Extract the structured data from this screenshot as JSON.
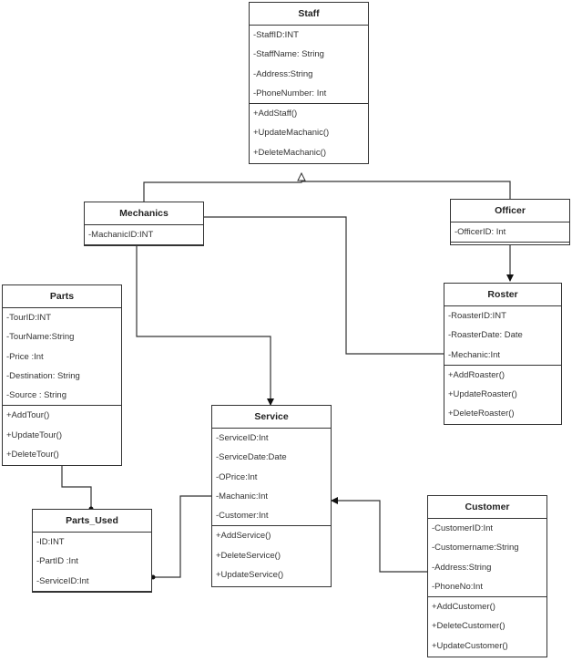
{
  "diagram": {
    "type": "UML class diagram",
    "classes": {
      "staff": {
        "name": "Staff",
        "attributes": [
          "-StaffID:INT",
          "-StaffName: String",
          "-Address:String",
          "-PhoneNumber: Int"
        ],
        "methods": [
          "+AddStaff()",
          "+UpdateMachanic()",
          "+DeleteMachanic()"
        ]
      },
      "mechanics": {
        "name": "Mechanics",
        "attributes": [
          "-MachanicID:INT"
        ],
        "methods": []
      },
      "officer": {
        "name": "Officer",
        "attributes": [
          "-OfficerID: Int"
        ],
        "methods": []
      },
      "roster": {
        "name": "Roster",
        "attributes": [
          "-RoasterID:INT",
          "-RoasterDate: Date",
          "-Mechanic:Int"
        ],
        "methods": [
          "+AddRoaster()",
          "+UpdateRoaster()",
          "+DeleteRoaster()"
        ]
      },
      "parts": {
        "name": "Parts",
        "attributes": [
          "-TourID:INT",
          "-TourName:String",
          "-Price :Int",
          "-Destination: String",
          "-Source : String"
        ],
        "methods": [
          "+AddTour()",
          "+UpdateTour()",
          "+DeleteTour()"
        ]
      },
      "service": {
        "name": "Service",
        "attributes": [
          "-ServiceID:Int",
          "-ServiceDate:Date",
          "-OPrice:Int",
          "-Machanic:Int",
          "-Customer:Int"
        ],
        "methods": [
          "+AddService()",
          "+DeleteService()",
          "+UpdateService()"
        ]
      },
      "parts_used": {
        "name": "Parts_Used",
        "attributes": [
          "-ID:INT",
          "-PartID :Int",
          "-ServiceID:Int"
        ],
        "methods": []
      },
      "customer": {
        "name": "Customer",
        "attributes": [
          "-CustomerID:Int",
          "-Customername:String",
          "-Address:String",
          "-PhoneNo:Int"
        ],
        "methods": [
          "+AddCustomer()",
          "+DeleteCustomer()",
          "+UpdateCustomer()"
        ]
      }
    },
    "relationships": [
      {
        "from": "Mechanics",
        "to": "Staff",
        "type": "generalization"
      },
      {
        "from": "Officer",
        "to": "Staff",
        "type": "generalization"
      },
      {
        "from": "Officer",
        "to": "Roster",
        "type": "association-directed"
      },
      {
        "from": "Mechanics",
        "to": "Roster",
        "type": "association"
      },
      {
        "from": "Mechanics",
        "to": "Service",
        "type": "association-directed"
      },
      {
        "from": "Customer",
        "to": "Service",
        "type": "association-directed"
      },
      {
        "from": "Parts",
        "to": "Parts_Used",
        "type": "composition"
      },
      {
        "from": "Service",
        "to": "Parts_Used",
        "type": "composition"
      }
    ]
  }
}
